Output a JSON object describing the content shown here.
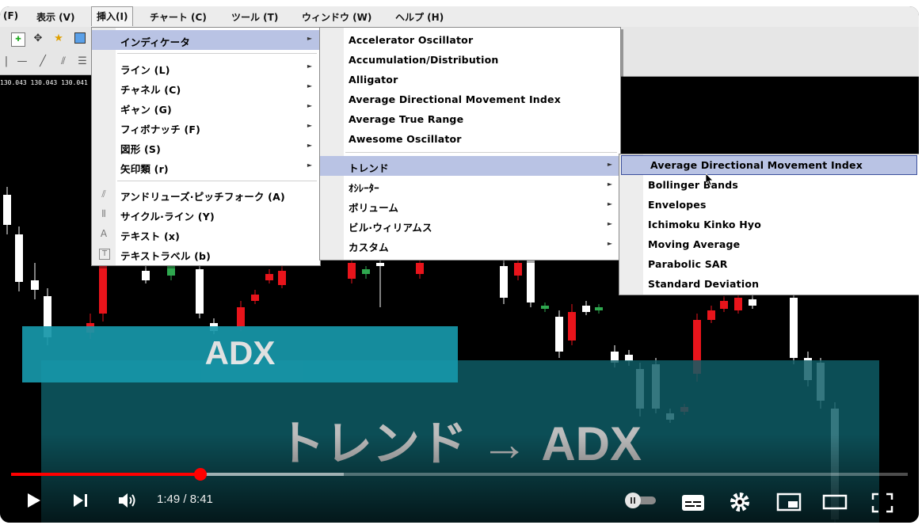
{
  "menubar": {
    "file": "(F)",
    "view": "表示 (V)",
    "insert": "挿入(I)",
    "charts": "チャート (C)",
    "tools": "ツール (T)",
    "window": "ウィンドウ (W)",
    "help": "ヘルプ (H)"
  },
  "price_row": "130.043 130.043 130.041",
  "insert_menu": {
    "indicators": "インディケータ",
    "lines": "ライン (L)",
    "channels": "チャネル (C)",
    "gann": "ギャン (G)",
    "fibonacci": "フィボナッチ (F)",
    "shapes": "図形 (S)",
    "arrows": "矢印類 (r)",
    "andrews": "アンドリューズ·ピッチフォーク (A)",
    "cycle": "サイクル·ライン (Y)",
    "text": "テキスト (x)",
    "text_label": "テキストラベル (b)"
  },
  "indicators_menu": {
    "items": [
      "Accelerator Oscillator",
      "Accumulation/Distribution",
      "Alligator",
      "Average Directional Movement Index",
      "Average True Range",
      "Awesome Oscillator"
    ],
    "trend": "トレンド",
    "oscillators": "ｵｼﾚｰﾀｰ",
    "volumes": "ボリューム",
    "bill_williams": "ビル·ウィリアムス",
    "custom": "カスタム"
  },
  "trend_menu": {
    "items": [
      "Average Directional Movement Index",
      "Bollinger Bands",
      "Envelopes",
      "Ichimoku Kinko Hyo",
      "Moving Average",
      "Parabolic SAR",
      "Standard Deviation"
    ]
  },
  "overlay": {
    "banner": "ADX",
    "caption": "トレンド → ADX"
  },
  "player": {
    "time": "1:49 / 8:41",
    "played_fraction": 0.211,
    "buffered_fraction": 0.371
  },
  "colors": {
    "bull": "#ffffff",
    "bear": "#e8141b",
    "doji": "#2fa84f",
    "menu_highlight": "#b9c3e4",
    "banner": "#1797a9",
    "progress": "#ff0000"
  }
}
